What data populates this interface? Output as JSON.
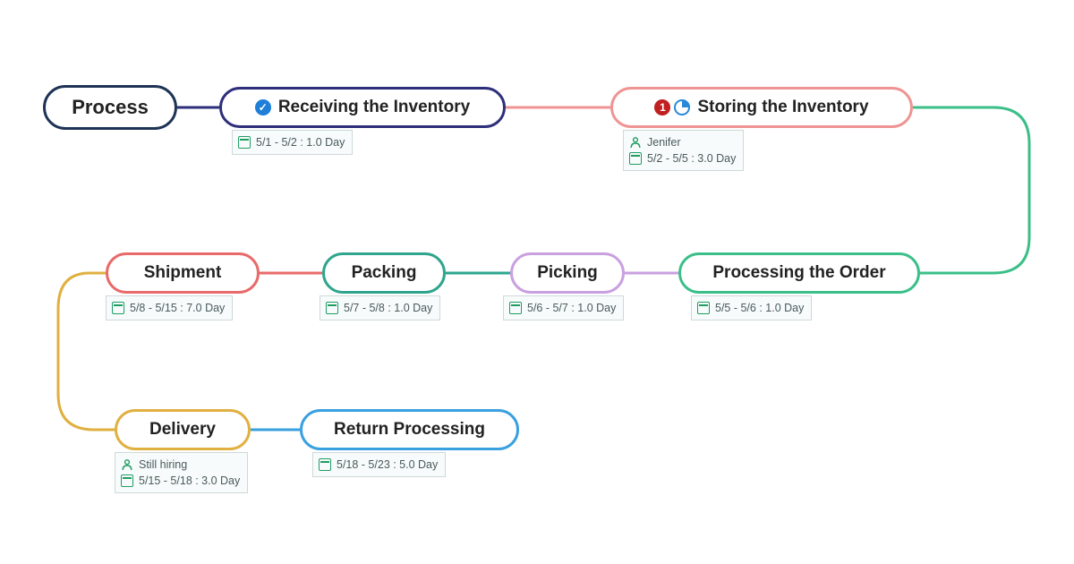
{
  "nodes": {
    "process": {
      "label": "Process"
    },
    "receiving": {
      "label": "Receiving the Inventory",
      "date": "5/1 - 5/2 : 1.0 Day"
    },
    "storing": {
      "label": "Storing the Inventory",
      "priority": "1",
      "assignee": "Jenifer",
      "date": "5/2 - 5/5 : 3.0 Day"
    },
    "processing": {
      "label": "Processing the Order",
      "date": "5/5 - 5/6 : 1.0 Day"
    },
    "picking": {
      "label": "Picking",
      "date": "5/6 - 5/7 : 1.0 Day"
    },
    "packing": {
      "label": "Packing",
      "date": "5/7 - 5/8 : 1.0 Day"
    },
    "shipment": {
      "label": "Shipment",
      "date": "5/8 - 5/15 : 7.0 Day"
    },
    "delivery": {
      "label": "Delivery",
      "assignee": "Still hiring",
      "date": "5/15 - 5/18 : 3.0 Day"
    },
    "return": {
      "label": "Return Processing",
      "date": "5/18 - 5/23 : 5.0 Day"
    }
  },
  "colors": {
    "process": "#1e3356",
    "receiving": "#2e2f7a",
    "storing": "#f09393",
    "processing": "#3bbf88",
    "picking": "#c9a0e0",
    "packing": "#2fa58d",
    "shipment": "#e86a6a",
    "delivery": "#e0b040",
    "return": "#3aa0e0"
  },
  "icons": {
    "check": "check-badge",
    "priority": "num-badge",
    "progress": "pie-badge",
    "calendar": "cal-icon",
    "person": "person-icon"
  }
}
